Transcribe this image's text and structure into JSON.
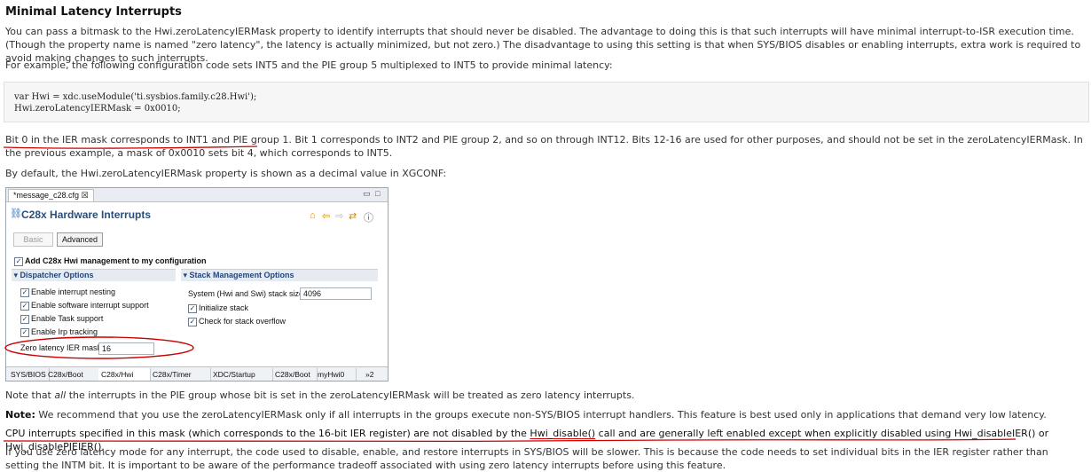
{
  "heading": "Minimal Latency Interrupts",
  "para1": "You can pass a bitmask to the Hwi.zeroLatencyIERMask property to identify interrupts that should never be disabled. The advantage to doing this is that such interrupts will have minimal interrupt-to-ISR execution time. (Though the property name is named \"zero latency\", the latency is actually minimized, but not zero.) The disadvantage to using this setting is that when SYS/BIOS disables or enabling interrupts, extra work is required to avoid making changes to such interrupts.",
  "para2": "For example, the following configuration code sets INT5 and the PIE group 5 multiplexed to INT5 to provide minimal latency:",
  "code": {
    "line1": "var Hwi = xdc.useModule('ti.sysbios.family.c28.Hwi');",
    "line2": "Hwi.zeroLatencyIERMask = 0x0010;"
  },
  "para3": {
    "underlined": "Bit 0 in the IER mask corresponds to INT1 and PIE group 1.",
    "rest": " Bit 1 corresponds to INT2 and PIE group 2, and so on through INT12. Bits 12-16 are used for other purposes, and should not be set in the zeroLatencyIERMask. In the previous example, a mask of 0x0010 sets bit 4, which corresponds to INT5."
  },
  "para4": "By default, the Hwi.zeroLatencyIERMask property is shown as a decimal value in XGCONF:",
  "screenshot": {
    "editor_tab": "*message_c28.cfg ☒",
    "title": "C28x Hardware Interrupts",
    "btn_basic": "Basic",
    "btn_advanced": "Advanced",
    "add_mgmt": "Add C28x Hwi management to my configuration",
    "dispatcher_header": "Dispatcher Options",
    "stack_header": "Stack Management Options",
    "dispatcher_items": [
      "Enable interrupt nesting",
      "Enable software interrupt support",
      "Enable Task support",
      "Enable Irp tracking"
    ],
    "stack_size_label": "System (Hwi and Swi) stack size",
    "stack_size_value": "4096",
    "init_stack": "Initialize stack",
    "check_overflow": "Check for stack overflow",
    "zero_latency_label": "Zero latency IER mask",
    "zero_latency_value": "16",
    "bottom_tabs": [
      "SYS/BIOS",
      "C28x/Boot",
      "C28x/Hwi",
      "C28x/Timer",
      "XDC/Startup",
      "C28x/Boot",
      "myHwi0",
      "»2"
    ]
  },
  "para5": {
    "pre": "Note that ",
    "italic": "all",
    "post": " the interrupts in the PIE group whose bit is set in the zeroLatencyIERMask will be treated as zero latency interrupts."
  },
  "para6": {
    "bold": "Note:",
    "rest": " We recommend that you use the zeroLatencyIERMask only if all interrupts in the groups execute non-SYS/BIOS interrupt handlers. This feature is best used only in applications that demand very low latency."
  },
  "para7": {
    "part1": "CPU interrupts specified in this mask (which corresponds to the 16-bit IER register) are not disabled by the ",
    "part2": "Hwi_disable()",
    "part3": " call and are generally left enabled except when explicitly disabled using Hwi_disableIER() or Hwi_disablePIEIER()."
  },
  "para8": "If you use zero latency mode for any interrupt, the code used to disable, enable, and restore interrupts in SYS/BIOS will be slower. This is because the code needs to set individual bits in the IER register rather than setting the INTM bit. It is important to be aware of the performance tradeoff associated with using zero latency interrupts before using this feature.",
  "colors": {
    "annotation": "#cc0000",
    "section_blue": "#22467a"
  }
}
